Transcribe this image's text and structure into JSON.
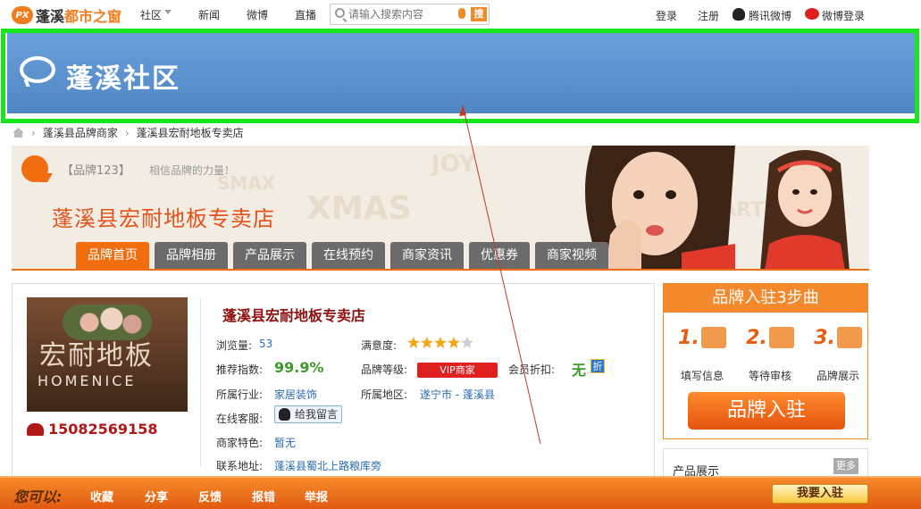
{
  "topbar": {
    "logo_text_1": "蓬溪",
    "logo_text_2": "都市之窗",
    "logo_mark": "PX",
    "nav": [
      "社区",
      "新闻",
      "微博",
      "直播"
    ],
    "search_placeholder": "请输入搜索内容",
    "search_button": "搜",
    "login": "登录",
    "register": "注册",
    "tencent_weibo": "腾讯微博",
    "weibo_login": "微博登录"
  },
  "banner": {
    "title": "蓬溪社区"
  },
  "breadcrumb": [
    "蓬溪县品牌商家",
    "蓬溪县宏耐地板专卖店"
  ],
  "brand_header": {
    "brand123": "【品牌123】",
    "slogan": "相信品牌的力量！",
    "shop_name": "蓬溪县宏耐地板专卖店",
    "bg_words": [
      "XMAS",
      "XMAS",
      "JOY",
      "PARTY",
      "SMAX"
    ],
    "tabs": [
      "品牌首页",
      "品牌相册",
      "产品展示",
      "在线预约",
      "商家资讯",
      "优惠券",
      "商家视频"
    ],
    "active_tab": "品牌首页"
  },
  "shop_info": {
    "photo_text_cn": "宏耐地板",
    "photo_text_en": "HOMENICE",
    "phone": "15082569158",
    "name": "蓬溪县宏耐地板专卖店",
    "views_label": "浏览量:",
    "views": "53",
    "satisfaction_label": "满意度:",
    "satisfaction_stars": 4,
    "satisfaction_max": 5,
    "rec_label": "推荐指数:",
    "rec_value": "99.9%",
    "level_label": "品牌等级:",
    "level_value": "VIP商家",
    "discount_label": "会员折扣:",
    "discount_value": "无",
    "discount_badge": "折",
    "industry_label": "所属行业:",
    "industry_value": "家居装饰",
    "region_label": "所属地区:",
    "region_value": "遂宁市 - 蓬溪县",
    "service_label": "在线客服:",
    "service_button": "给我留言",
    "feature_label": "商家特色:",
    "feature_value": "暂无",
    "address_label": "联系地址:",
    "address_value": "蓬溪县蜀北上路粮库旁"
  },
  "sidebar": {
    "steps_title": "品牌入驻3步曲",
    "steps": [
      {
        "num": "1.",
        "label": "填写信息"
      },
      {
        "num": "2.",
        "label": "等待审核"
      },
      {
        "num": "3.",
        "label": "品牌展示"
      }
    ],
    "join_button": "品牌入驻",
    "products_title": "产品展示",
    "more": "更多"
  },
  "bottombar": {
    "you_can": "您可以:",
    "actions": [
      "收藏",
      "分享",
      "反馈",
      "报错",
      "举报"
    ],
    "join": "我要入驻"
  },
  "colors": {
    "accent_orange": "#f06e10",
    "banner_blue": "#5b92cf",
    "highlight_green": "#19e51c",
    "link_blue": "#2b6cb0"
  }
}
